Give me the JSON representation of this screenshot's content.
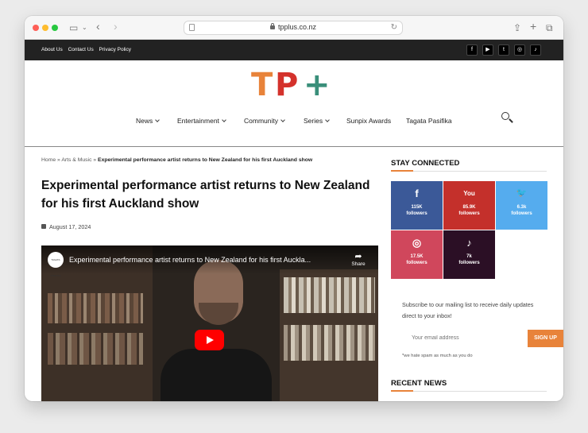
{
  "browser": {
    "url": "tpplus.co.nz"
  },
  "topbar": {
    "links": [
      "About Us",
      "Contact Us",
      "Privacy Policy"
    ],
    "social_icons": [
      "facebook-icon",
      "youtube-icon",
      "twitter-icon",
      "instagram-icon",
      "tiktok-icon"
    ]
  },
  "logo": {
    "letters": [
      "T",
      "P",
      "+"
    ],
    "colors": [
      "#e8833a",
      "#d4322c",
      "#3a8f7a"
    ]
  },
  "nav": {
    "items": [
      "News",
      "Entertainment",
      "Community",
      "Series",
      "Sunpix Awards",
      "Tagata Pasifika"
    ]
  },
  "article": {
    "breadcrumb_home": "Home",
    "breadcrumb_sep": "»",
    "breadcrumb_section": "Arts & Music",
    "breadcrumb_current": "Experimental performance artist returns to New Zealand for his first Auckland show",
    "title": "Experimental performance artist returns to New Zealand for his first Auckland show",
    "date": "August 17, 2024"
  },
  "video": {
    "title": "Experimental performance artist returns to New Zealand for his first Auckla...",
    "share_label": "Share",
    "channel_badge": "TAGATA PASIFIKA"
  },
  "sidebar": {
    "stay_connected": "STAY CONNECTED",
    "tiles": [
      {
        "icon": "facebook-icon",
        "glyph": "f",
        "count": "115K",
        "label": "followers",
        "color": "#3b5998"
      },
      {
        "icon": "youtube-icon",
        "glyph": "You",
        "count": "85.9K",
        "label": "followers",
        "color": "#c4302b"
      },
      {
        "icon": "twitter-icon",
        "glyph": "🐦",
        "count": "6.3k",
        "label": "followers",
        "color": "#55acee"
      },
      {
        "icon": "instagram-icon",
        "glyph": "◎",
        "count": "17.5K",
        "label": "followers",
        "color": "#d0475c"
      },
      {
        "icon": "tiktok-icon",
        "glyph": "♪",
        "count": "7k",
        "label": "followers",
        "color": "#2b0f25"
      }
    ],
    "subscribe_text": "Subscribe to our mailing list to receive daily updates direct to your inbox!",
    "email_placeholder": "Your email address",
    "signup_label": "SIGN UP",
    "spam_note": "*we hate spam as much as you do",
    "recent_news": "RECENT NEWS",
    "accent_color": "#e8833a"
  }
}
